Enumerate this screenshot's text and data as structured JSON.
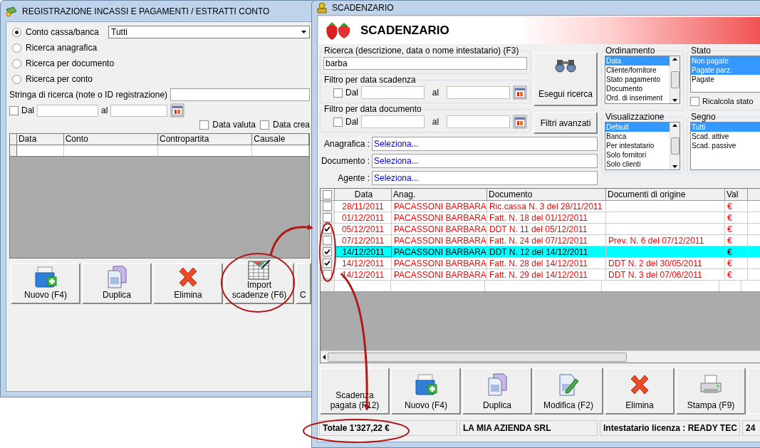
{
  "left_window": {
    "title": "REGISTRAZIONE INCASSI E PAGAMENTI / ESTRATTI CONTO",
    "search_modes": [
      {
        "label": "Conto cassa/banca",
        "selected": true
      },
      {
        "label": "Ricerca anagrafica",
        "selected": false
      },
      {
        "label": "Ricerca per documento",
        "selected": false
      },
      {
        "label": "Ricerca per conto",
        "selected": false
      }
    ],
    "account_select": {
      "value": "Tutti"
    },
    "search_string": {
      "label": "Stringa di ricerca (note o ID registrazione)"
    },
    "date_filter": {
      "checked": false,
      "from_label": "Dal",
      "to_label": "al"
    },
    "date_options": [
      {
        "label": "Data valuta",
        "checked": false
      },
      {
        "label": "Data crea",
        "checked": false
      }
    ],
    "table": {
      "columns": [
        "Data",
        "Conto",
        "Contropartita",
        "Causale"
      ]
    },
    "buttons": [
      {
        "label": "Nuovo (F4)",
        "kind": "new"
      },
      {
        "label": "Duplica",
        "kind": "copy"
      },
      {
        "label": "Elimina",
        "kind": "delete"
      },
      {
        "label": "Import scadenze (F6)",
        "kind": "import"
      },
      {
        "label": "C",
        "kind": "plain"
      }
    ]
  },
  "right_window": {
    "title": "SCADENZARIO",
    "header_title": "SCADENZARIO",
    "search": {
      "legend": "Ricerca (descrizione, data o nome intestatario) (F3)",
      "value": "barba"
    },
    "date_filters": [
      {
        "legend": "Filtro per data scadenza",
        "checked": false,
        "from_label": "Dal",
        "to_label": "al"
      },
      {
        "legend": "Filtro per data documento",
        "checked": false,
        "from_label": "Dal",
        "to_label": "al"
      }
    ],
    "search_button": "Esegui ricerca",
    "advanced_button": "Filtri avanzati",
    "lookups": [
      {
        "label": "Anagrafica :",
        "value": "Seleziona..."
      },
      {
        "label": "Documento :",
        "value": "Seleziona..."
      },
      {
        "label": "Agente :",
        "value": "Seleziona..."
      }
    ],
    "sort": {
      "legend": "Ordinamento",
      "items": [
        {
          "label": "Data",
          "selected": true
        },
        {
          "label": "Cliente/fornitore",
          "selected": false
        },
        {
          "label": "Stato pagamento",
          "selected": false
        },
        {
          "label": "Documento",
          "selected": false
        },
        {
          "label": "Ord. di inseriment",
          "selected": false
        }
      ]
    },
    "status_filter": {
      "legend": "Stato",
      "items": [
        {
          "label": "Non pagate",
          "selected": true
        },
        {
          "label": "Pagate parz.",
          "selected": true
        },
        {
          "label": "Pagate",
          "selected": false
        }
      ],
      "recalc": {
        "label": "Ricalcola stato",
        "checked": false
      }
    },
    "view": {
      "legend": "Visualizzazione",
      "items": [
        {
          "label": "Default",
          "selected": true
        },
        {
          "label": "Banca",
          "selected": false
        },
        {
          "label": "Per intestatario",
          "selected": false
        },
        {
          "label": "Solo fornitori",
          "selected": false
        },
        {
          "label": "Solo clienti",
          "selected": false
        }
      ]
    },
    "sign": {
      "legend": "Segno",
      "items": [
        {
          "label": "Tutti",
          "selected": true
        },
        {
          "label": "Scad. attive",
          "selected": false
        },
        {
          "label": "Scad. passive",
          "selected": false
        }
      ]
    },
    "table": {
      "all_checked": false,
      "columns": [
        "Data",
        "Anag.",
        "Documento",
        "Documenti di origine",
        "Val"
      ],
      "rows": [
        {
          "date": "28/11/2011",
          "anag": "PACASSONI BARBARA",
          "document": "Ric.cassa N. 3 del 28/11/2011",
          "origin": "",
          "currency": "€",
          "checked": false,
          "selected": false
        },
        {
          "date": "01/12/2011",
          "anag": "PACASSONI BARBARA",
          "document": "Fatt. N. 18 del 01/12/2011",
          "origin": "",
          "currency": "€",
          "checked": false,
          "selected": false
        },
        {
          "date": "05/12/2011",
          "anag": "PACASSONI BARBARA",
          "document": "DDT N. 11 del 05/12/2011",
          "origin": "",
          "currency": "€",
          "checked": true,
          "selected": false
        },
        {
          "date": "07/12/2011",
          "anag": "PACASSONI BARBARA",
          "document": "Fatt. N. 24 del 07/12/2011",
          "origin": "Prev. N. 6 del 07/12/2011",
          "currency": "€",
          "checked": false,
          "selected": false
        },
        {
          "date": "14/12/2011",
          "anag": "PACASSONI BARBARA",
          "document": "DDT N. 12 del 14/12/2011",
          "origin": "",
          "currency": "€",
          "checked": true,
          "selected": true
        },
        {
          "date": "14/12/2011",
          "anag": "PACASSONI BARBARA",
          "document": "Fatt. N. 28 del 14/12/2011",
          "origin": "DDT N. 2 del 30/05/2011",
          "currency": "€",
          "checked": true,
          "selected": false
        },
        {
          "date": "14/12/2011",
          "anag": "PACASSONI BARBARA",
          "document": "Fatt. N. 29 del 14/12/2011",
          "origin": "DDT N. 3 del 07/06/2011",
          "currency": "€",
          "checked": false,
          "selected": false
        }
      ]
    },
    "buttons": [
      {
        "label": "Scadenza pagata (F12)",
        "kind": "plain"
      },
      {
        "label": "Nuovo (F4)",
        "kind": "new"
      },
      {
        "label": "Duplica",
        "kind": "copy"
      },
      {
        "label": "Modifica (F2)",
        "kind": "edit"
      },
      {
        "label": "Elimina",
        "kind": "delete"
      },
      {
        "label": "Stampa (F9)",
        "kind": "print"
      }
    ],
    "status_bar": [
      "Totale 1'327,22 €",
      "LA MIA AZIENDA SRL",
      "Intestatario licenza : READY TEC",
      "24"
    ]
  }
}
